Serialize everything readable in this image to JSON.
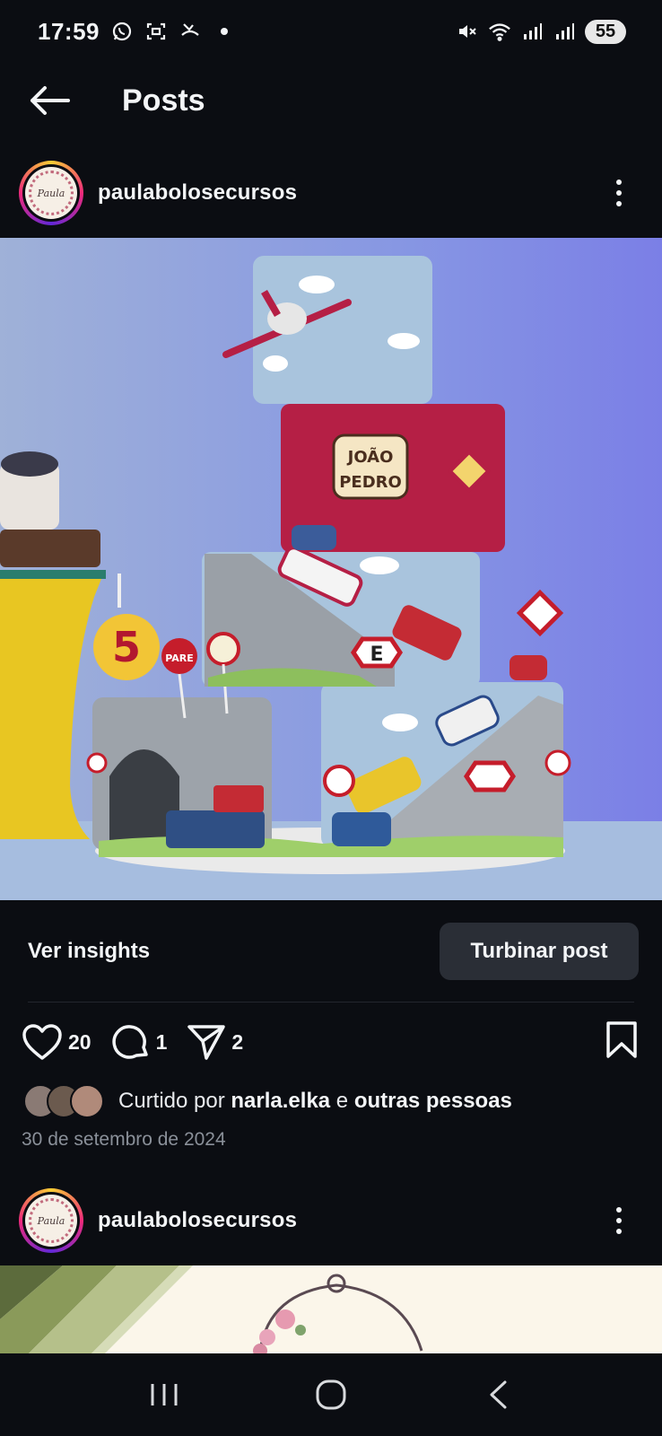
{
  "status": {
    "time": "17:59",
    "battery": "55",
    "icons": [
      "whatsapp-icon",
      "screenshot-icon",
      "missed-call-icon",
      "dot-icon",
      "mute-icon",
      "wifi-icon",
      "signal-icon",
      "signal-icon"
    ]
  },
  "app_bar": {
    "title": "Posts"
  },
  "posts": [
    {
      "username": "paulabolosecursos",
      "avatar_text": "Paula"
    },
    {
      "username": "paulabolosecursos",
      "avatar_text": "Paula"
    }
  ],
  "post": {
    "image_text": {
      "name_top": "JOÃO",
      "name_bottom": "PEDRO",
      "age": "5",
      "sign_pare": "PARE",
      "sign_e": "E"
    },
    "insights_label": "Ver insights",
    "boost_label": "Turbinar post",
    "likes": "20",
    "comments": "1",
    "shares": "2",
    "liked_prefix": "Curtido por ",
    "liked_user": "narla.elka",
    "liked_middle": " e ",
    "liked_others": "outras pessoas",
    "date": "30 de setembro de 2024"
  },
  "colors": {
    "background": "#0b0d12",
    "button": "#2a2e36",
    "muted": "#8a9099"
  }
}
